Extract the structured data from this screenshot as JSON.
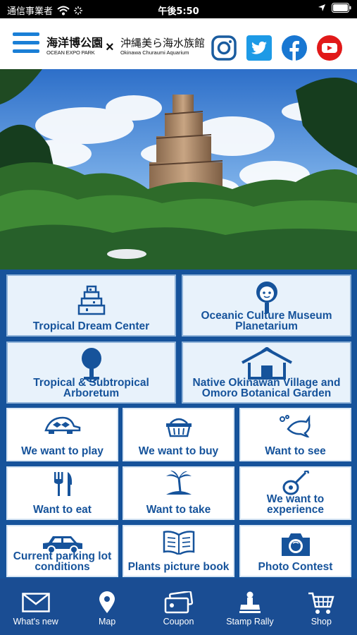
{
  "status_bar": {
    "carrier": "通信事業者",
    "time": "午後5:50"
  },
  "header": {
    "logo1_jp": "海洋博公園",
    "logo1_en": "OCEAN EXPO PARK",
    "separator": "×",
    "logo2_jp": "沖縄美ら海水族館",
    "logo2_en": "Okinawa Churaumi Aquarium"
  },
  "facilities": [
    {
      "label": "Tropical Dream Center",
      "icon": "tower-icon"
    },
    {
      "label": "Oceanic Culture Museum Planetarium",
      "icon": "mascot-icon"
    },
    {
      "label": "Tropical & Subtropical Arboretum",
      "icon": "tree-icon"
    },
    {
      "label": "Native Okinawan Village and Omoro Botanical Garden",
      "icon": "house-icon"
    }
  ],
  "actions": [
    {
      "label": "We want to play",
      "icon": "turtle-icon"
    },
    {
      "label": "We want to buy",
      "icon": "basket-icon"
    },
    {
      "label": "Want to see",
      "icon": "dolphin-icon"
    },
    {
      "label": "Want to eat",
      "icon": "fork-knife-icon"
    },
    {
      "label": "Want to take",
      "icon": "palm-island-icon"
    },
    {
      "label": "We want to experience",
      "icon": "sanshin-icon"
    },
    {
      "label": "Current parking lot conditions",
      "icon": "car-icon"
    },
    {
      "label": "Plants picture book",
      "icon": "book-icon"
    },
    {
      "label": "Photo Contest",
      "icon": "camera-icon"
    }
  ],
  "tabbar": [
    {
      "label": "What's new",
      "icon": "envelope-icon"
    },
    {
      "label": "Map",
      "icon": "map-pin-icon"
    },
    {
      "label": "Coupon",
      "icon": "coupon-icon"
    },
    {
      "label": "Stamp Rally",
      "icon": "stamp-icon"
    },
    {
      "label": "Shop",
      "icon": "cart-icon"
    }
  ],
  "colors": {
    "brand_blue": "#16539b",
    "tile_bg": "#e8f2fb",
    "menu_blue": "#1a7fd6"
  }
}
